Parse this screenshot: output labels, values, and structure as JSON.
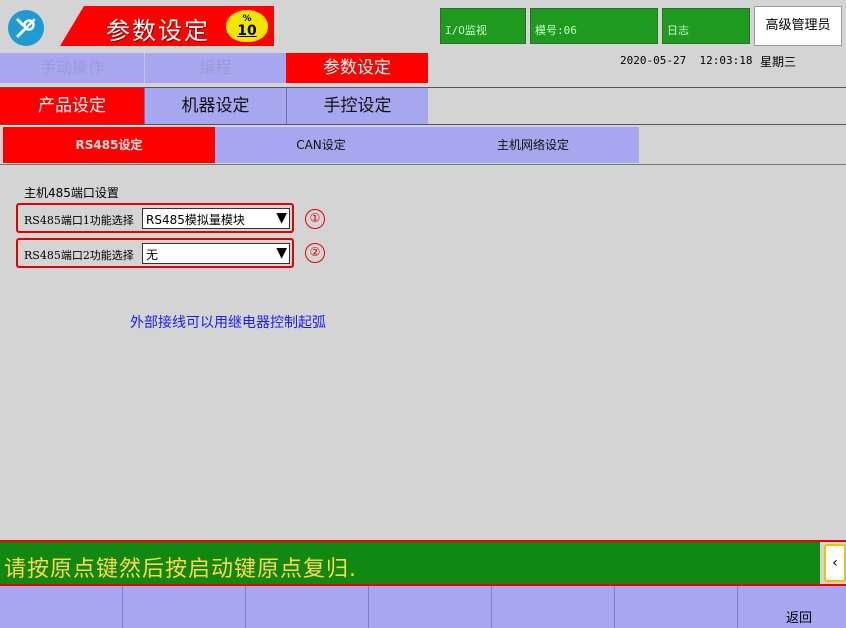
{
  "header": {
    "title": "参数设定",
    "badge_symbol": "%",
    "badge_value": "10",
    "io_monitor": "I/O监视",
    "model": "模号:06",
    "log": "日志",
    "user_level": "高级管理员",
    "datetime": "2020-05-27  12:03:18",
    "weekday": "星期三"
  },
  "mode_tabs": {
    "manual": "手动操作",
    "program": "编程",
    "params": "参数设定"
  },
  "settings_tabs": {
    "product": "产品设定",
    "machine": "机器设定",
    "manual_ctl": "手控设定"
  },
  "comm_tabs": {
    "rs485": "RS485设定",
    "can": "CAN设定",
    "host_net": "主机网络设定"
  },
  "main": {
    "section_title": "主机485端口设置",
    "port1": {
      "label": "RS485端口1功能选择",
      "value": "RS485模拟量模块",
      "mark": "①"
    },
    "port2": {
      "label": "RS485端口2功能选择",
      "value": "无",
      "mark": "②"
    },
    "note": "外部接线可以用继电器控制起弧"
  },
  "status_bar": {
    "message": "请按原点键然后按启动键原点复归.",
    "scroll_glyph": "‹"
  },
  "bottom_bar": {
    "back_label": "返回"
  },
  "colors": {
    "active_red": "#ff0000",
    "tab_lavender": "#a7a7f0",
    "header_green": "#1e9a1e",
    "status_green": "#118811",
    "status_text": "#ffd84a",
    "note_blue": "#1a1aff"
  },
  "icons": {
    "app": "wrench-screwdriver-icon",
    "dropdown": "triangle-down-icon"
  }
}
